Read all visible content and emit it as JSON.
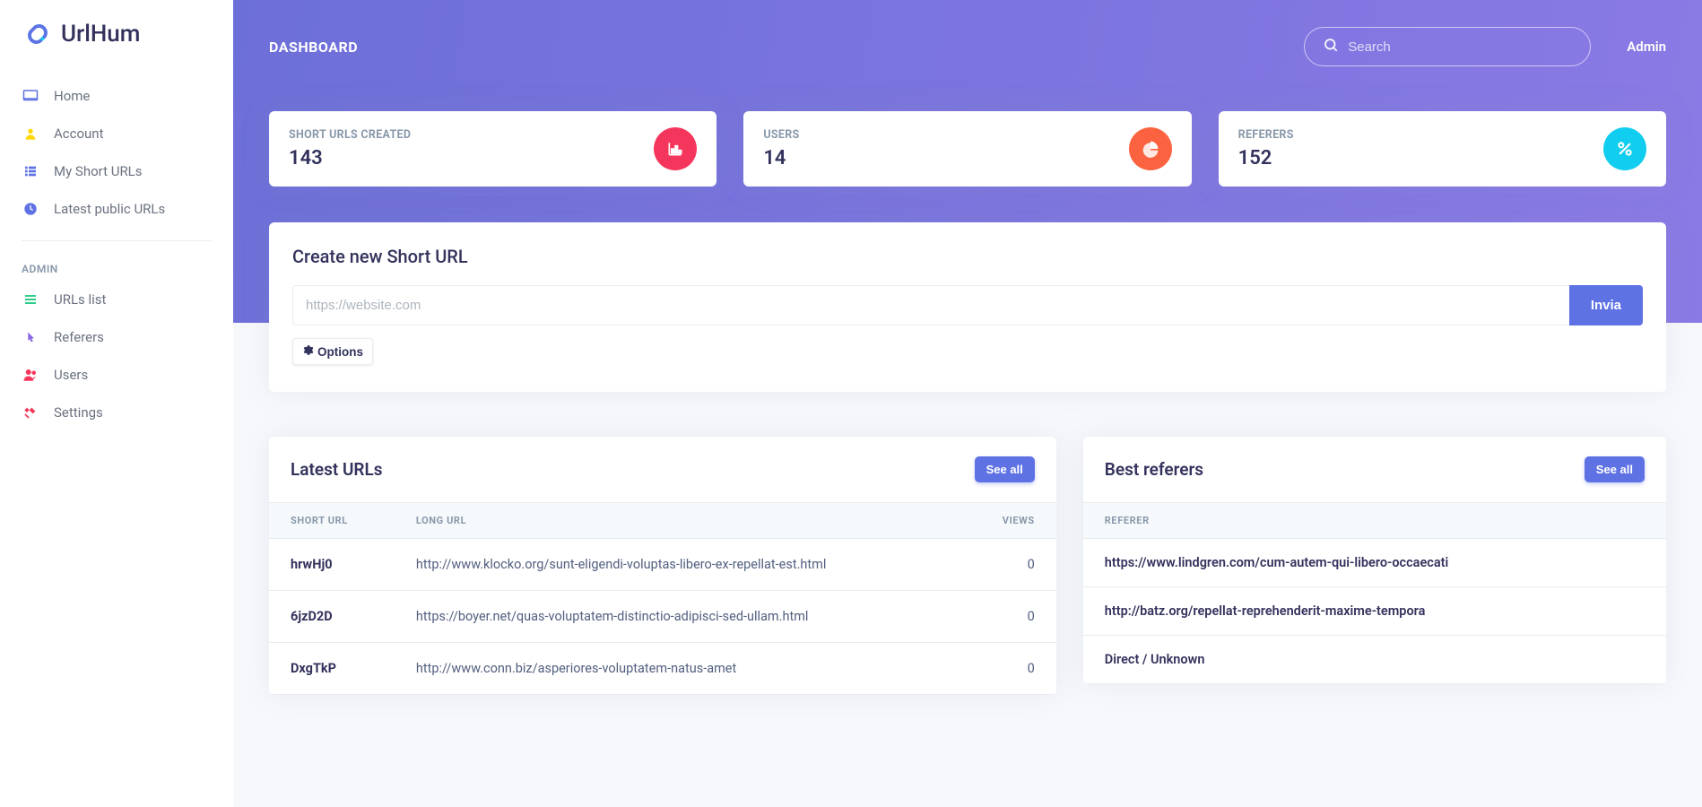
{
  "brand": "UrlHum",
  "sidebar": {
    "items": [
      {
        "label": "Home",
        "icon": "monitor",
        "color": "#5e72e4"
      },
      {
        "label": "Account",
        "icon": "user",
        "color": "#ffd600"
      },
      {
        "label": "My Short URLs",
        "icon": "list",
        "color": "#5e72e4"
      },
      {
        "label": "Latest public URLs",
        "icon": "clock",
        "color": "#5e72e4"
      }
    ],
    "admin_heading": "ADMIN",
    "admin_items": [
      {
        "label": "URLs list",
        "icon": "menu",
        "color": "#2dce89"
      },
      {
        "label": "Referers",
        "icon": "pointer",
        "color": "#8965e0"
      },
      {
        "label": "Users",
        "icon": "users",
        "color": "#f5365c"
      },
      {
        "label": "Settings",
        "icon": "tools",
        "color": "#f5365c"
      }
    ]
  },
  "header": {
    "title": "DASHBOARD",
    "search_placeholder": "Search",
    "user": "Admin"
  },
  "stats": [
    {
      "label": "SHORT URLS CREATED",
      "value": "143",
      "color": "bg-red",
      "icon": "chart"
    },
    {
      "label": "USERS",
      "value": "14",
      "color": "bg-orange",
      "icon": "pie"
    },
    {
      "label": "REFERERS",
      "value": "152",
      "color": "bg-cyan",
      "icon": "percent"
    }
  ],
  "create": {
    "title": "Create new Short URL",
    "placeholder": "https://website.com",
    "submit": "Invia",
    "options": "Options"
  },
  "latest": {
    "title": "Latest URLs",
    "see_all": "See all",
    "cols": {
      "short": "SHORT URL",
      "long": "LONG URL",
      "views": "VIEWS"
    },
    "rows": [
      {
        "short": "hrwHj0",
        "long": "http://www.klocko.org/sunt-eligendi-voluptas-libero-ex-repellat-est.html",
        "views": "0"
      },
      {
        "short": "6jzD2D",
        "long": "https://boyer.net/quas-voluptatem-distinctio-adipisci-sed-ullam.html",
        "views": "0"
      },
      {
        "short": "DxgTkP",
        "long": "http://www.conn.biz/asperiores-voluptatem-natus-amet",
        "views": "0"
      }
    ]
  },
  "referers": {
    "title": "Best referers",
    "see_all": "See all",
    "col": "REFERER",
    "rows": [
      "https://www.lindgren.com/cum-autem-qui-libero-occaecati",
      "http://batz.org/repellat-reprehenderit-maxime-tempora",
      "Direct / Unknown"
    ]
  }
}
